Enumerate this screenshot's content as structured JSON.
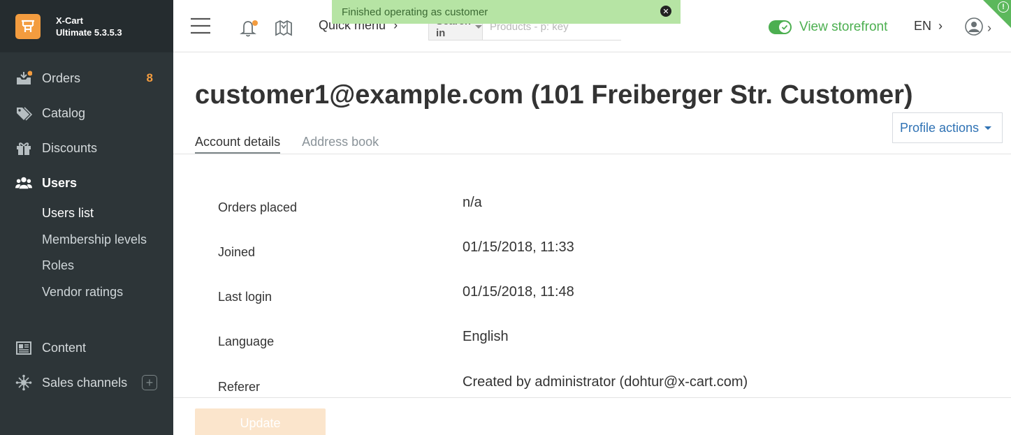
{
  "brand": {
    "name": "X-Cart",
    "version": "Ultimate 5.3.5.3"
  },
  "sidebar": {
    "items": [
      {
        "label": "Orders",
        "badge": "8"
      },
      {
        "label": "Catalog"
      },
      {
        "label": "Discounts"
      },
      {
        "label": "Users"
      },
      {
        "label": "Content"
      },
      {
        "label": "Sales channels"
      }
    ],
    "users_sub": [
      {
        "label": "Users list"
      },
      {
        "label": "Membership levels"
      },
      {
        "label": "Roles"
      },
      {
        "label": "Vendor ratings"
      }
    ]
  },
  "topbar": {
    "quick_menu": "Quick menu",
    "search_in": "Search in",
    "search_placeholder": "Products - p: key",
    "view_storefront": "View storefront",
    "language": "EN"
  },
  "notification": {
    "text": "Finished operating as customer"
  },
  "main": {
    "title": "customer1@example.com (101 Freiberger Str. Customer)",
    "profile_actions": "Profile actions",
    "tabs": [
      {
        "label": "Account details"
      },
      {
        "label": "Address book"
      }
    ],
    "fields": [
      {
        "label": "Orders placed",
        "value": "n/a"
      },
      {
        "label": "Joined",
        "value": "01/15/2018, 11:33"
      },
      {
        "label": "Last login",
        "value": "01/15/2018, 11:48"
      },
      {
        "label": "Language",
        "value": "English"
      },
      {
        "label": "Referer",
        "value": "Created by administrator (dohtur@x-cart.com)"
      }
    ],
    "update_button": "Update"
  },
  "colors": {
    "sidebar_bg": "#2d3538",
    "accent_orange": "#f39c3f",
    "storefront_green": "#4caf50",
    "link_blue": "#2f72b4",
    "notice_bg": "#b6e4a4"
  },
  "icons": [
    "hamburger-icon",
    "bell-icon",
    "map-icon",
    "chevron-right-icon",
    "user-avatar-icon",
    "orders-icon",
    "catalog-tag-icon",
    "gift-icon",
    "users-icon",
    "content-icon",
    "sales-channels-icon",
    "plus-icon",
    "close-icon",
    "alert-icon"
  ]
}
